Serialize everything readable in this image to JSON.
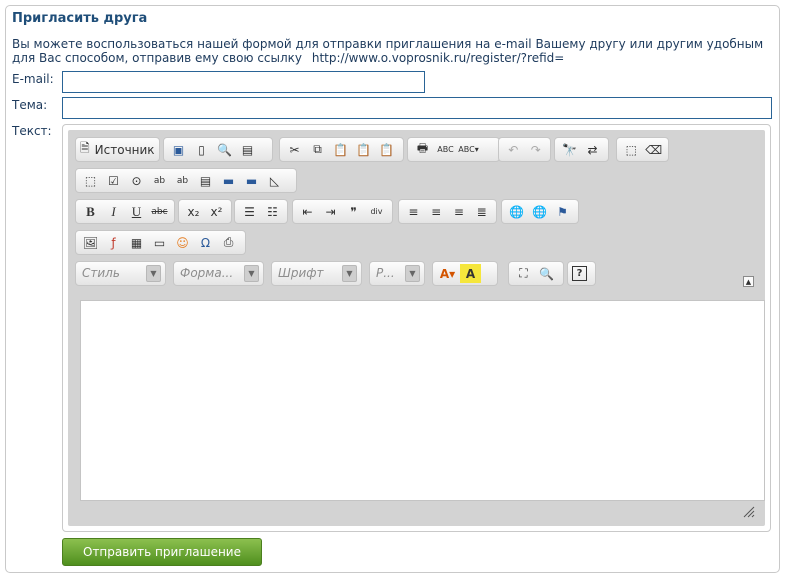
{
  "form": {
    "title": "Пригласить друга",
    "description": "Вы можете воспользоваться нашей формой для отправки приглашения на e-mail Вашему другу или другим удобным для Вас способом, отправив ему свою ссылку",
    "referral_url": "http://www.o.voprosnik.ru/register/?refid=",
    "email_label": "E-mail:",
    "email_value": "",
    "subject_label": "Тема:",
    "subject_value": "",
    "text_label": "Текст:",
    "submit_label": "Отправить приглашение"
  },
  "editor": {
    "source_label": "Источник",
    "style_placeholder": "Стиль",
    "format_placeholder": "Форма...",
    "font_placeholder": "Шрифт",
    "size_placeholder": "Р...",
    "content": ""
  },
  "icons": [
    "document-icon",
    "save-icon",
    "new-page-icon",
    "preview-icon",
    "templates-icon",
    "cut-icon",
    "copy-icon",
    "paste-icon",
    "paste-text-icon",
    "paste-word-icon",
    "print-icon",
    "spellcheck-icon",
    "spellcheck-dropdown-icon",
    "undo-icon",
    "redo-icon",
    "find-icon",
    "replace-icon",
    "select-all-icon",
    "remove-format-icon",
    "form-icon",
    "checkbox-icon",
    "radio-icon",
    "textfield-icon",
    "textarea-icon",
    "select-icon",
    "button-icon",
    "image-button-icon",
    "hidden-field-icon",
    "bold-icon",
    "italic-icon",
    "underline-icon",
    "strikethrough-icon",
    "subscript-icon",
    "superscript-icon",
    "numbered-list-icon",
    "bulleted-list-icon",
    "outdent-icon",
    "indent-icon",
    "blockquote-icon",
    "div-icon",
    "align-left-icon",
    "align-center-icon",
    "align-right-icon",
    "justify-icon",
    "link-icon",
    "unlink-icon",
    "anchor-icon",
    "image-icon",
    "flash-icon",
    "table-icon",
    "horizontal-rule-icon",
    "smiley-icon",
    "special-char-icon",
    "page-break-icon",
    "text-color-icon",
    "bg-color-icon",
    "maximize-icon",
    "show-blocks-icon",
    "about-icon",
    "collapse-toolbar-icon",
    "resize-handle-icon"
  ]
}
